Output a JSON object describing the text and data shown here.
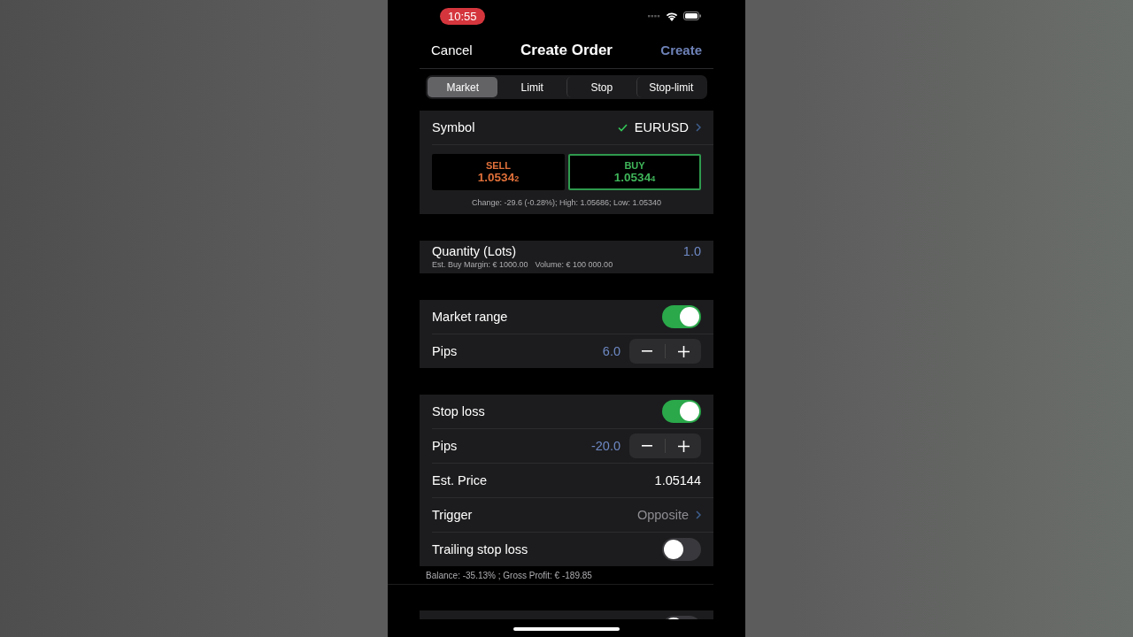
{
  "status_bar": {
    "time": "10:55"
  },
  "nav": {
    "cancel": "Cancel",
    "title": "Create Order",
    "create": "Create"
  },
  "order_types": [
    {
      "label": "Market",
      "selected": true
    },
    {
      "label": "Limit",
      "selected": false
    },
    {
      "label": "Stop",
      "selected": false
    },
    {
      "label": "Stop-limit",
      "selected": false
    }
  ],
  "symbol": {
    "label": "Symbol",
    "value": "EURUSD",
    "valid": true
  },
  "quotes": [
    {
      "kind": "sell",
      "label": "SELL",
      "price": "1.0534$_{2}$",
      "selected": false
    },
    {
      "kind": "buy",
      "label": "BUY",
      "price": "1.0534$_{4}$",
      "selected": true
    }
  ],
  "market_info": "Change: -29.6 (-0.28%); High: 1.05686; Low: 1.05340",
  "quantity": {
    "label": "Quantity (Lots)",
    "value": "1.0",
    "info": [
      "Est. Buy Margin: € 1000.00",
      "Volume: € 100 000.00"
    ]
  },
  "sections": [
    {
      "rows": [
        {
          "kind": "toggle",
          "label": "Market range",
          "on": true
        },
        {
          "kind": "stepper",
          "label": "Pips",
          "value": "6.0"
        }
      ]
    },
    {
      "rows": [
        {
          "kind": "toggle",
          "label": "Stop loss",
          "on": true
        },
        {
          "kind": "stepper",
          "label": "Pips",
          "value": "-20.0"
        },
        {
          "kind": "value",
          "label": "Est. Price",
          "value": "1.05144"
        },
        {
          "kind": "link",
          "label": "Trigger",
          "value": "Opposite"
        },
        {
          "kind": "toggle",
          "label": "Trailing stop loss",
          "on": false
        }
      ],
      "footer": "Balance: -35.13% ; Gross Profit: € -189.85"
    },
    {
      "rows": [
        {
          "kind": "toggle",
          "on": false
        }
      ]
    }
  ]
}
